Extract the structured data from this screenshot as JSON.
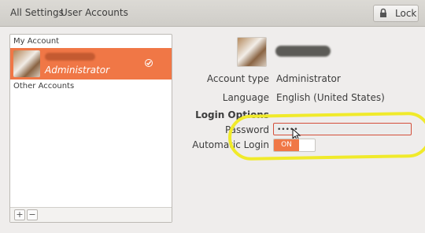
{
  "topbar": {
    "all_settings": "All Settings",
    "title": "User Accounts",
    "lock_label": "Lock",
    "lock_icon": "lock-icon"
  },
  "accounts": {
    "my_account_header": "My Account",
    "current_user": {
      "role": "Administrator",
      "status_icon": "check-icon"
    },
    "other_accounts_header": "Other Accounts",
    "add_label": "+",
    "remove_label": "−"
  },
  "details": {
    "account_type": {
      "label": "Account type",
      "value": "Administrator"
    },
    "language": {
      "label": "Language",
      "value": "English (United States)"
    },
    "login_options_header": "Login Options",
    "password": {
      "label": "Password",
      "value": "•••••"
    },
    "automatic_login": {
      "label": "Automatic Login",
      "state_text": "ON"
    }
  },
  "colors": {
    "accent": "#f07746",
    "highlight": "#f0ea2a",
    "window_bg": "#efedec"
  }
}
